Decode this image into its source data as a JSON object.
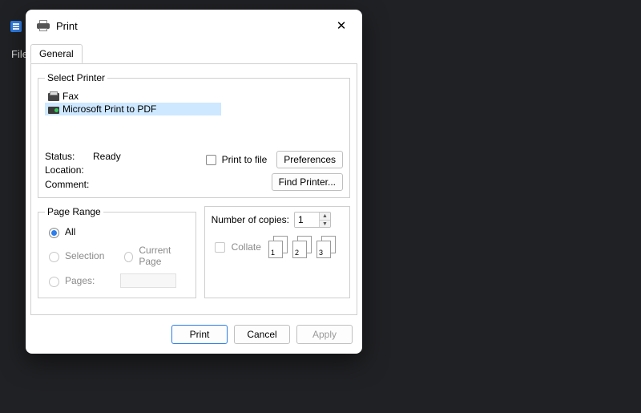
{
  "background": {
    "file_menu": "File"
  },
  "dialog": {
    "title": "Print",
    "tabs": {
      "general": "General"
    },
    "select_printer": {
      "legend": "Select Printer",
      "items": [
        "Fax",
        "Microsoft Print to PDF"
      ],
      "selected_index": 1
    },
    "info": {
      "status_label": "Status:",
      "status_value": "Ready",
      "location_label": "Location:",
      "location_value": "",
      "comment_label": "Comment:",
      "comment_value": ""
    },
    "print_to_file_label": "Print to file",
    "buttons": {
      "preferences": "Preferences",
      "find_printer": "Find Printer...",
      "print": "Print",
      "cancel": "Cancel",
      "apply": "Apply"
    },
    "page_range": {
      "legend": "Page Range",
      "all": "All",
      "selection": "Selection",
      "current_page": "Current Page",
      "pages": "Pages:"
    },
    "copies": {
      "label": "Number of copies:",
      "value": "1",
      "collate": "Collate",
      "illus": [
        "1",
        "1",
        "2",
        "2",
        "3",
        "3"
      ]
    }
  }
}
